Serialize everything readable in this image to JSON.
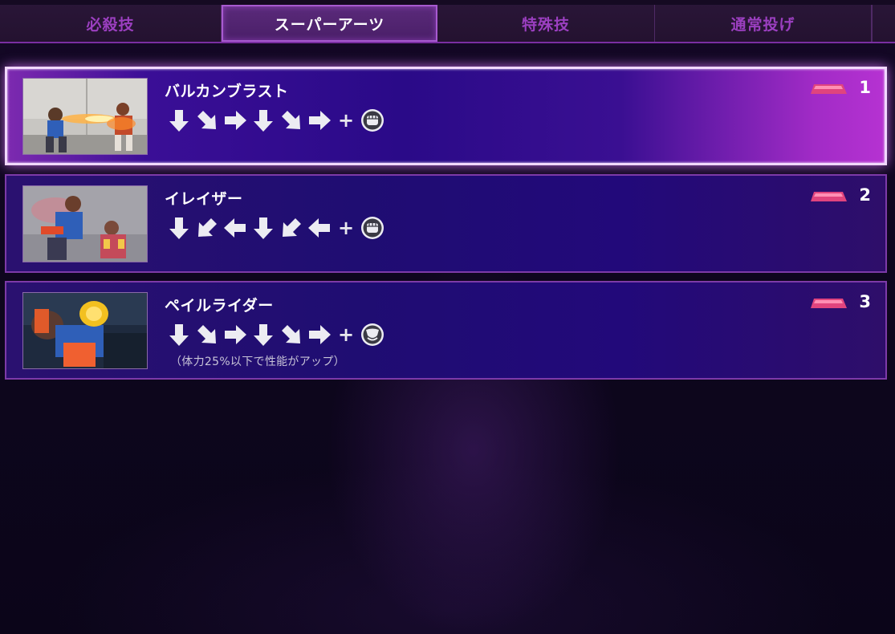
{
  "tabs": [
    {
      "label": "必殺技",
      "active": false
    },
    {
      "label": "スーパーアーツ",
      "active": true
    },
    {
      "label": "特殊技",
      "active": false
    },
    {
      "label": "通常投げ",
      "active": false
    }
  ],
  "moves": [
    {
      "name": "バルカンブラスト",
      "level": "1",
      "selected": true,
      "inputs": [
        "down-arrow",
        "down-forward-arrow",
        "forward-arrow",
        "down-arrow",
        "down-forward-arrow",
        "forward-arrow"
      ],
      "plus": "+",
      "button": "punch-icon",
      "note": ""
    },
    {
      "name": "イレイザー",
      "level": "2",
      "selected": false,
      "inputs": [
        "down-arrow",
        "down-back-arrow",
        "back-arrow",
        "down-arrow",
        "down-back-arrow",
        "back-arrow"
      ],
      "plus": "+",
      "button": "punch-icon",
      "note": ""
    },
    {
      "name": "ペイルライダー",
      "level": "3",
      "selected": false,
      "inputs": [
        "down-arrow",
        "down-forward-arrow",
        "forward-arrow",
        "down-arrow",
        "down-forward-arrow",
        "forward-arrow"
      ],
      "plus": "+",
      "button": "kick-icon",
      "note": "（体力25%以下で性能がアップ）"
    }
  ],
  "colors": {
    "accent": "#a75ad0",
    "gauge": "#e0447e",
    "card_bg": "#1f0d72"
  }
}
